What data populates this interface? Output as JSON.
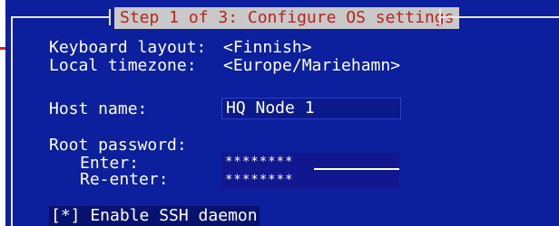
{
  "window": {
    "title": "Step 1 of 3: Configure OS settings"
  },
  "settings": {
    "keyboard_layout": {
      "label": "Keyboard layout:",
      "value": "<Finnish>"
    },
    "local_timezone": {
      "label": "Local timezone:",
      "value": "<Europe/Mariehamn>"
    },
    "host_name": {
      "label": "Host name:",
      "value": "HQ Node 1"
    },
    "root_password": {
      "label": "Root password:",
      "enter_label": "Enter:",
      "reenter_label": "Re-enter:",
      "enter_mask": "********",
      "reenter_mask": "********"
    },
    "ssh": {
      "label": "[*] Enable SSH daemon"
    }
  },
  "colors": {
    "panel_background": "#0c1f9c",
    "title_bar_background": "#c9c9c9",
    "title_text": "#b8241f",
    "pointer": "#d81d1d"
  }
}
